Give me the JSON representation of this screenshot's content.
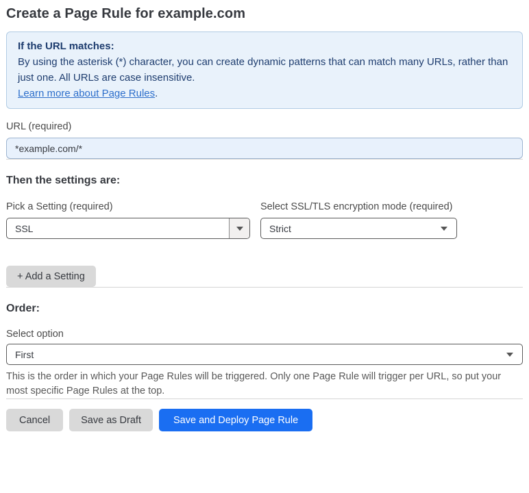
{
  "page": {
    "title": "Create a Page Rule for example.com"
  },
  "info_box": {
    "heading": "If the URL matches:",
    "body": "By using the asterisk (*) character, you can create dynamic patterns that can match many URLs, rather than just one. All URLs are case insensitive.",
    "link_label": "Learn more about Page Rules",
    "link_suffix": "."
  },
  "url_field": {
    "label": "URL (required)",
    "value": "*example.com/*"
  },
  "settings_section": {
    "heading": "Then the settings are:",
    "setting_select": {
      "label": "Pick a Setting (required)",
      "value": "SSL"
    },
    "mode_select": {
      "label": "Select SSL/TLS encryption mode (required)",
      "value": "Strict"
    },
    "add_setting_label": "+ Add a Setting"
  },
  "order_section": {
    "heading": "Order:",
    "select": {
      "label": "Select option",
      "value": "First"
    },
    "help_text": "This is the order in which your Page Rules will be triggered. Only one Page Rule will trigger per URL, so put your most specific Page Rules at the top."
  },
  "actions": {
    "cancel_label": "Cancel",
    "save_draft_label": "Save as Draft",
    "save_deploy_label": "Save and Deploy Page Rule"
  },
  "colors": {
    "accent_blue": "#1a6ef2",
    "info_box_background": "#e9f2fb",
    "info_box_border": "#b1cbe4",
    "info_text_navy": "#1d3c6e",
    "link_blue": "#2c6ecb",
    "url_input_background": "#e8f1fc",
    "gray_button_background": "#d9d9d9",
    "select_border": "#595959"
  },
  "icons": {
    "dropdown_arrow": "chevron-down"
  }
}
